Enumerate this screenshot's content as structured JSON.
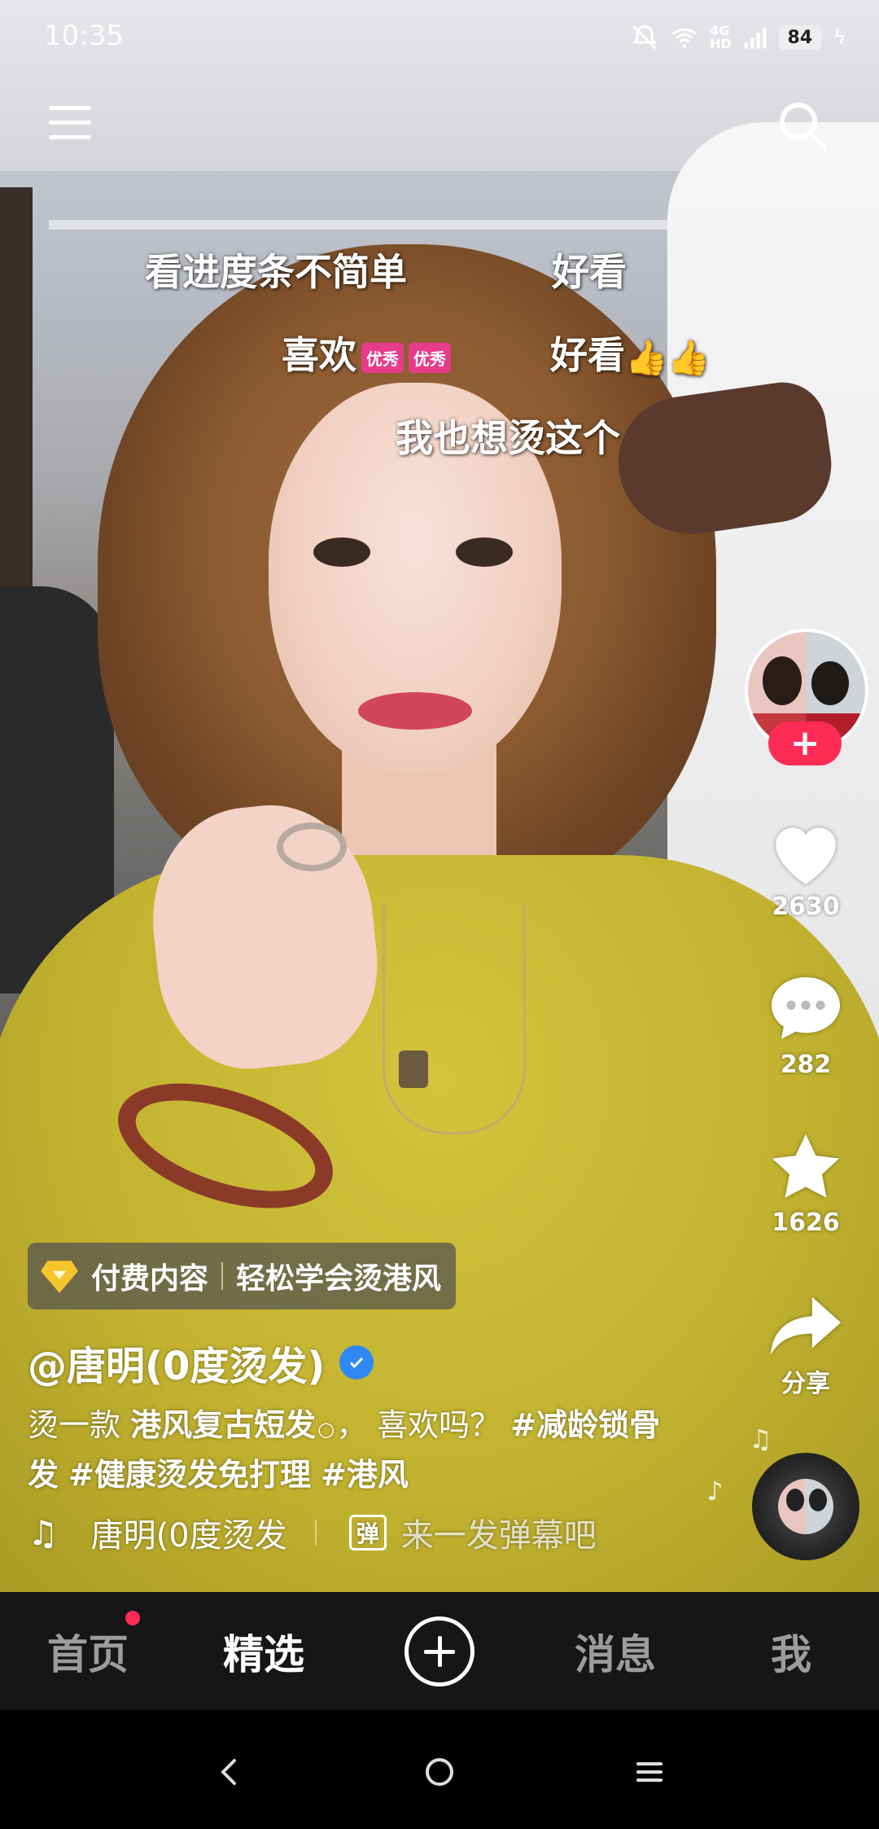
{
  "status_bar": {
    "time": "10:35",
    "network": "4G",
    "hd": "HD",
    "battery": "84"
  },
  "danmaku": [
    {
      "text": "看进度条不简单"
    },
    {
      "text": "好看"
    },
    {
      "text": "喜欢",
      "badges": [
        "优秀",
        "优秀"
      ]
    },
    {
      "text": "好看",
      "suffix": "👍👍"
    },
    {
      "text": "我也想烫这个"
    }
  ],
  "rail": {
    "like_count": "2630",
    "comment_count": "282",
    "favorite_count": "1626",
    "share_label": "分享"
  },
  "paid_tag": {
    "label": "付费内容",
    "title": "轻松学会烫港风"
  },
  "author": "@唐明(0度烫发)",
  "caption": {
    "prefix": "烫一款 ",
    "keyword": "港风复古短发",
    "middle": "， 喜欢吗？ ",
    "tag1": "#减龄锁骨发",
    "tag2": "#健康烫发免打理",
    "tag3": "#港风"
  },
  "music": {
    "title": "唐明(0度烫发",
    "danmu_icon": "弹",
    "danmu_placeholder": "来一发弹幕吧"
  },
  "tabs": [
    {
      "label": "首页",
      "has_dot": true
    },
    {
      "label": "精选",
      "active": true
    },
    {
      "label": "消息"
    },
    {
      "label": "我"
    }
  ],
  "colors": {
    "accent": "#fe2c55",
    "verified": "#2f88f5",
    "badge": "#e83b8a",
    "tab_bar": "#161616"
  }
}
